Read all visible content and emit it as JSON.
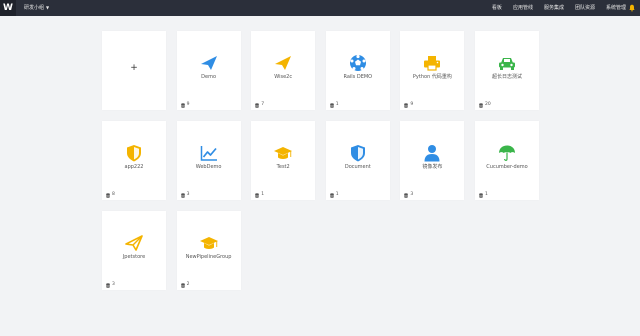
{
  "header": {
    "logo_text": "W",
    "team_label": "研发小组",
    "nav": [
      "看板",
      "应用管线",
      "服务集成",
      "团队资源",
      "系统管理"
    ]
  },
  "add_card": {
    "symbol": "+"
  },
  "projects": [
    {
      "name": "Demo",
      "count": "9",
      "icon": "paper-plane-icon",
      "color": "#2f8de4"
    },
    {
      "name": "Wise2c",
      "count": "7",
      "icon": "paper-plane-icon",
      "color": "#f4b400"
    },
    {
      "name": "Rails DEMO",
      "count": "1",
      "icon": "soccer-ball-icon",
      "color": "#2f8de4"
    },
    {
      "name": "Python 代码重构",
      "count": "9",
      "icon": "printer-icon",
      "color": "#f4b400"
    },
    {
      "name": "超长日志测试",
      "count": "20",
      "icon": "car-icon",
      "color": "#3ab54a"
    },
    {
      "name": "app222",
      "count": "8",
      "icon": "shield-icon",
      "color": "#f4b400"
    },
    {
      "name": "WebDemo",
      "count": "3",
      "icon": "line-chart-icon",
      "color": "#2f8de4"
    },
    {
      "name": "Test2",
      "count": "1",
      "icon": "graduation-cap-icon",
      "color": "#f4b400"
    },
    {
      "name": "Document",
      "count": "1",
      "icon": "shield-icon",
      "color": "#2f8de4"
    },
    {
      "name": "镜像发布",
      "count": "3",
      "icon": "user-icon",
      "color": "#2f8de4"
    },
    {
      "name": "Cucumber-demo",
      "count": "1",
      "icon": "umbrella-icon",
      "color": "#3ab54a"
    },
    {
      "name": "Jpetstore",
      "count": "3",
      "icon": "paper-plane-outline-icon",
      "color": "#f4b400"
    },
    {
      "name": "NewPipelineGroup",
      "count": "2",
      "icon": "graduation-cap-icon",
      "color": "#f4b400"
    }
  ]
}
